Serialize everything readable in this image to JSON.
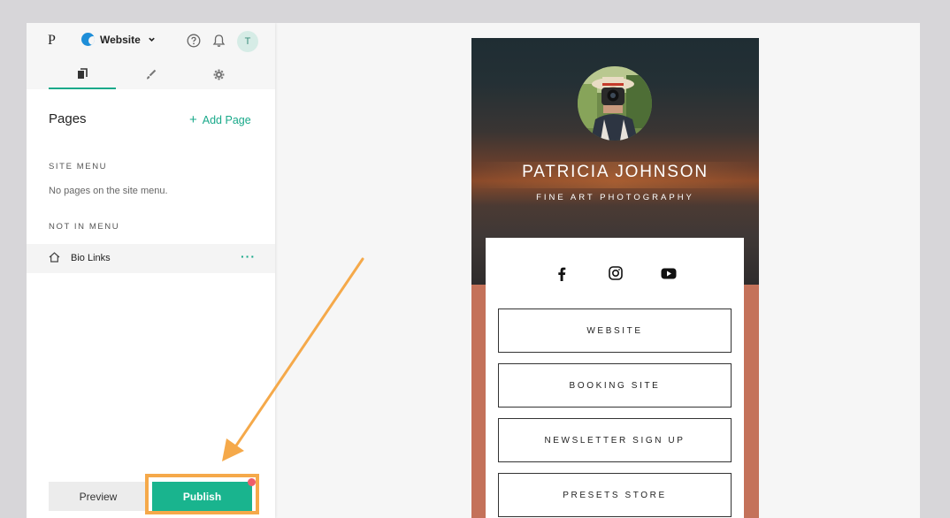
{
  "header": {
    "logo": "P",
    "site_name": "Website",
    "avatar_initial": "T"
  },
  "tabs": [
    {
      "name": "pages",
      "icon": "pages-icon",
      "active": true
    },
    {
      "name": "design",
      "icon": "brush-icon",
      "active": false
    },
    {
      "name": "settings",
      "icon": "gear-icon",
      "active": false
    }
  ],
  "pages_panel": {
    "title": "Pages",
    "add_page_label": "Add Page",
    "site_menu_label": "SITE MENU",
    "site_menu_empty": "No pages on the site menu.",
    "not_in_menu_label": "NOT IN MENU",
    "pages": [
      {
        "name": "Bio Links",
        "icon": "home-icon",
        "more": "···"
      }
    ]
  },
  "footer": {
    "preview_label": "Preview",
    "publish_label": "Publish",
    "publish_notification": true
  },
  "preview": {
    "name": "PATRICIA JOHNSON",
    "subtitle": "FINE ART PHOTOGRAPHY",
    "social_icons": [
      "facebook-icon",
      "instagram-icon",
      "youtube-icon"
    ],
    "links": [
      "WEBSITE",
      "BOOKING SITE",
      "NEWSLETTER SIGN UP",
      "PRESETS STORE"
    ],
    "background_color": "#c4725a"
  },
  "colors": {
    "accent": "#19b48e",
    "annotation": "#f5a94a",
    "notification": "#ee5d6a"
  }
}
